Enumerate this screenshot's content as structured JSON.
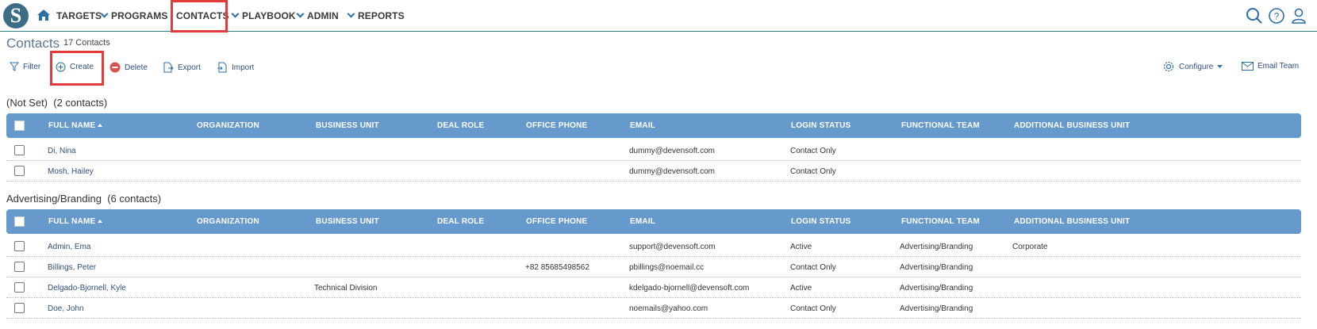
{
  "nav": {
    "logo_letter": "S",
    "items": [
      {
        "label": "TARGETS",
        "chevron": false
      },
      {
        "label": "PROGRAMS",
        "chevron": true
      },
      {
        "label": "CONTACTS",
        "chevron": false
      },
      {
        "label": "PLAYBOOK",
        "chevron": true
      },
      {
        "label": "ADMIN",
        "chevron": true
      },
      {
        "label": "REPORTS",
        "chevron": true
      }
    ]
  },
  "page": {
    "title": "Contacts",
    "count": "17 Contacts"
  },
  "toolbar": {
    "filter": "Filter",
    "create": "Create",
    "delete": "Delete",
    "export": "Export",
    "import": "Import",
    "configure": "Configure",
    "email_team": "Email Team"
  },
  "columns": {
    "full_name": "FULL NAME",
    "organization": "ORGANIZATION",
    "business_unit": "BUSINESS UNIT",
    "deal_role": "DEAL ROLE",
    "office_phone": "OFFICE PHONE",
    "email": "EMAIL",
    "login_status": "LOGIN STATUS",
    "functional_team": "FUNCTIONAL TEAM",
    "additional_business_unit": "ADDITIONAL BUSINESS UNIT"
  },
  "groups": [
    {
      "title": "(Not Set)",
      "count": "(2 contacts)",
      "rows": [
        {
          "name": "Di, Nina",
          "organization": "",
          "business_unit": "",
          "deal_role": "",
          "office_phone": "",
          "email": "dummy@devensoft.com",
          "login_status": "Contact Only",
          "functional_team": "",
          "additional_business_unit": ""
        },
        {
          "name": "Mosh, Hailey",
          "organization": "",
          "business_unit": "",
          "deal_role": "",
          "office_phone": "",
          "email": "dummy@devensoft.com",
          "login_status": "Contact Only",
          "functional_team": "",
          "additional_business_unit": ""
        }
      ]
    },
    {
      "title": "Advertising/Branding",
      "count": "(6 contacts)",
      "rows": [
        {
          "name": "Admin, Ema",
          "organization": "",
          "business_unit": "",
          "deal_role": "",
          "office_phone": "",
          "email": "support@devensoft.com",
          "login_status": "Active",
          "functional_team": "Advertising/Branding",
          "additional_business_unit": "Corporate"
        },
        {
          "name": "Billings, Peter",
          "organization": "",
          "business_unit": "",
          "deal_role": "",
          "office_phone": "+82 85685498562",
          "email": "pbillings@noemail.cc",
          "login_status": "Contact Only",
          "functional_team": "Advertising/Branding",
          "additional_business_unit": ""
        },
        {
          "name": "Delgado-Bjornell, Kyle",
          "organization": "",
          "business_unit": "Technical Division",
          "deal_role": "",
          "office_phone": "",
          "email": "kdelgado-bjornell@devensoft.com",
          "login_status": "Active",
          "functional_team": "Advertising/Branding",
          "additional_business_unit": ""
        },
        {
          "name": "Doe, John",
          "organization": "",
          "business_unit": "",
          "deal_role": "",
          "office_phone": "",
          "email": "noemails@yahoo.com",
          "login_status": "Contact Only",
          "functional_team": "Advertising/Branding",
          "additional_business_unit": ""
        }
      ]
    }
  ],
  "colors": {
    "header_bg": "#6699cc",
    "highlight": "#e23b3b",
    "link": "#2d4f7a",
    "title": "#5b7795"
  }
}
